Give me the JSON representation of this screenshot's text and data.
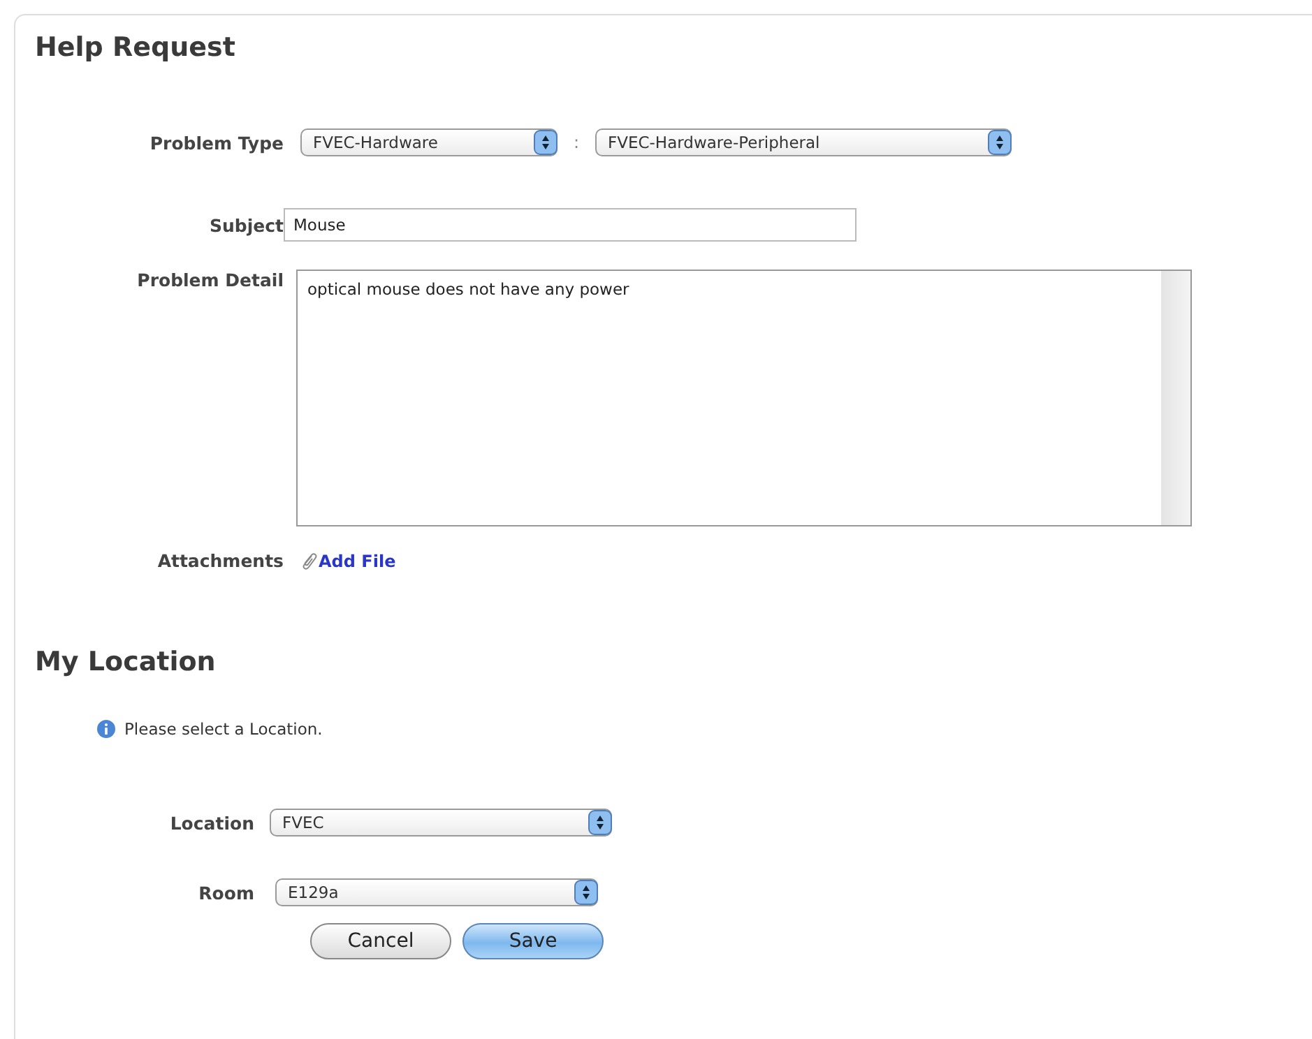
{
  "help_request": {
    "title": "Help Request",
    "problem_type": {
      "label": "Problem Type",
      "category": "FVEC-Hardware",
      "separator": ":",
      "subcategory": "FVEC-Hardware-Peripheral"
    },
    "subject": {
      "label": "Subject",
      "value": "Mouse"
    },
    "problem_detail": {
      "label": "Problem Detail",
      "value": "optical mouse does not have any power"
    },
    "attachments": {
      "label": "Attachments",
      "link": "Add File"
    }
  },
  "my_location": {
    "title": "My Location",
    "info": "Please select a Location.",
    "location": {
      "label": "Location",
      "value": "FVEC"
    },
    "room": {
      "label": "Room",
      "value": "E129a"
    },
    "buttons": [
      {
        "label": "Cancel",
        "kind": "default"
      },
      {
        "label": "Save",
        "kind": "primary"
      }
    ]
  }
}
